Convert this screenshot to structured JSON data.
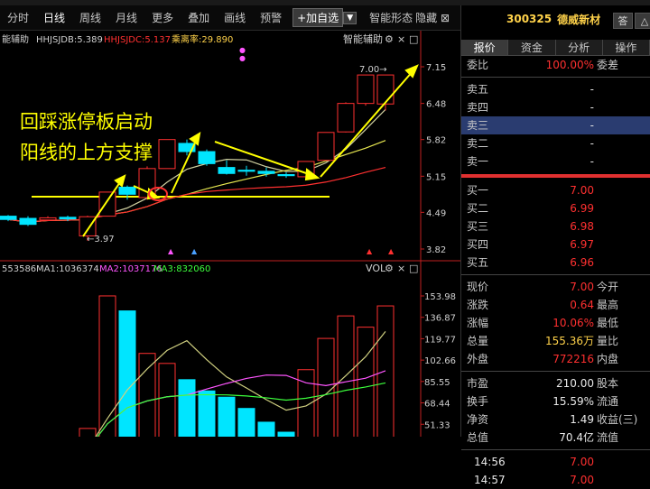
{
  "toolbar": {
    "items": [
      "分时",
      "日线",
      "周线",
      "月线",
      "更多",
      "叠加",
      "画线",
      "预警"
    ],
    "add_button": "+加自选",
    "smart": "智能形态",
    "hide": "隐藏"
  },
  "price_chart": {
    "indicators": [
      {
        "label": "能辅助",
        "color": "#d0d0d0"
      },
      {
        "label": "HHJSJDB:5.389",
        "color": "#d0d0d0"
      },
      {
        "label": "HHJSJDC:5.137",
        "color": "#ff3030"
      },
      {
        "label": "乘离率:29.890",
        "color": "#ffd24a"
      }
    ],
    "tool_label": "智能辅助",
    "annotation_line1": "回踩涨停板启动",
    "annotation_line2": "阳线的上方支撑",
    "high_label": "7.00",
    "low_label": "3.97",
    "y_axis": [
      "7.15",
      "6.48",
      "5.82",
      "5.15",
      "4.49",
      "3.82"
    ]
  },
  "volume_chart": {
    "indicators": [
      {
        "label": "553586",
        "color": "#d0d0d0"
      },
      {
        "label": "MA1:1036374",
        "color": "#d0d0d0"
      },
      {
        "label": "MA2:1037176",
        "color": "#ff55ff"
      },
      {
        "label": "MA3:832060",
        "color": "#3cff3c"
      }
    ],
    "tool_label": "VOL",
    "y_axis": [
      "153.98",
      "136.87",
      "119.77",
      "102.66",
      "85.55",
      "68.44",
      "51.33"
    ]
  },
  "chart_data": {
    "type": "candlestick",
    "y_axis_price": [
      3.82,
      4.49,
      5.15,
      5.82,
      6.48,
      7.15
    ],
    "y_axis_volume": [
      51.33,
      68.44,
      85.55,
      102.66,
      119.77,
      136.87,
      153.98
    ],
    "candles": [
      {
        "o": 4.42,
        "c": 4.36,
        "h": 4.44,
        "l": 4.33,
        "v": 30
      },
      {
        "o": 4.38,
        "c": 4.27,
        "h": 4.42,
        "l": 4.24,
        "v": 28
      },
      {
        "o": 4.35,
        "c": 4.39,
        "h": 4.42,
        "l": 4.33,
        "v": 24
      },
      {
        "o": 4.4,
        "c": 4.37,
        "h": 4.43,
        "l": 4.33,
        "v": 26
      },
      {
        "o": 4.06,
        "c": 4.41,
        "h": 4.43,
        "l": 3.97,
        "v": 48
      },
      {
        "o": 4.42,
        "c": 4.86,
        "h": 4.86,
        "l": 4.42,
        "v": 154
      },
      {
        "o": 4.95,
        "c": 4.82,
        "h": 4.98,
        "l": 4.72,
        "v": 142
      },
      {
        "o": 4.76,
        "c": 5.29,
        "h": 5.33,
        "l": 4.72,
        "v": 108
      },
      {
        "o": 5.29,
        "c": 5.82,
        "h": 5.82,
        "l": 5.29,
        "v": 100
      },
      {
        "o": 5.75,
        "c": 5.6,
        "h": 5.82,
        "l": 5.53,
        "v": 87
      },
      {
        "o": 5.6,
        "c": 5.38,
        "h": 5.64,
        "l": 5.34,
        "v": 78
      },
      {
        "o": 5.31,
        "c": 5.2,
        "h": 5.44,
        "l": 5.18,
        "v": 73
      },
      {
        "o": 5.26,
        "c": 5.24,
        "h": 5.34,
        "l": 5.16,
        "v": 64
      },
      {
        "o": 5.24,
        "c": 5.2,
        "h": 5.31,
        "l": 5.14,
        "v": 53
      },
      {
        "o": 5.18,
        "c": 5.16,
        "h": 5.22,
        "l": 5.12,
        "v": 45
      },
      {
        "o": 5.14,
        "c": 5.42,
        "h": 5.42,
        "l": 5.11,
        "v": 95
      },
      {
        "o": 5.44,
        "c": 5.95,
        "h": 5.95,
        "l": 5.44,
        "v": 120
      },
      {
        "o": 5.96,
        "c": 6.48,
        "h": 6.5,
        "l": 5.95,
        "v": 138
      },
      {
        "o": 6.48,
        "c": 7.0,
        "h": 7.0,
        "l": 6.44,
        "v": 129
      },
      {
        "o": 6.47,
        "c": 7.0,
        "h": 7.0,
        "l": 6.35,
        "v": 146
      }
    ]
  },
  "quote_panel": {
    "code": "300325",
    "name": "德威新材",
    "btn1": "答",
    "btn2": "△",
    "tabs": [
      "报价",
      "资金",
      "分析",
      "操作"
    ],
    "weibi_label": "委比",
    "weibi_value": "100.00%",
    "weicha_label": "委差",
    "sells": [
      {
        "label": "卖五",
        "value": "-"
      },
      {
        "label": "卖四",
        "value": "-"
      },
      {
        "label": "卖三",
        "value": "-"
      },
      {
        "label": "卖二",
        "value": "-"
      },
      {
        "label": "卖一",
        "value": "-"
      }
    ],
    "buys": [
      {
        "label": "买一",
        "value": "7.00"
      },
      {
        "label": "买二",
        "value": "6.99"
      },
      {
        "label": "买三",
        "value": "6.98"
      },
      {
        "label": "买四",
        "value": "6.97"
      },
      {
        "label": "买五",
        "value": "6.96"
      }
    ],
    "stats": [
      {
        "l1": "现价",
        "v1": "7.00",
        "c1": "red",
        "l2": "今开"
      },
      {
        "l1": "涨跌",
        "v1": "0.64",
        "c1": "red",
        "l2": "最高"
      },
      {
        "l1": "涨幅",
        "v1": "10.06%",
        "c1": "red",
        "l2": "最低"
      },
      {
        "l1": "总量",
        "v1": "155.36万",
        "c1": "yellow",
        "l2": "量比"
      },
      {
        "l1": "外盘",
        "v1": "772216",
        "c1": "red",
        "l2": "内盘"
      }
    ],
    "stats2": [
      {
        "l1": "市盈",
        "v1": "210.00",
        "c1": "white",
        "l2": "股本"
      },
      {
        "l1": "换手",
        "v1": "15.59%",
        "c1": "white",
        "l2": "流通"
      },
      {
        "l1": "净资",
        "v1": "1.49",
        "c1": "white",
        "l2": "收益(三)"
      },
      {
        "l1": "总值",
        "v1": "70.4亿",
        "c1": "white",
        "l2": "流值"
      }
    ],
    "ticks": [
      {
        "time": "14:56",
        "price": "7.00"
      },
      {
        "time": "14:57",
        "price": "7.00"
      }
    ]
  }
}
